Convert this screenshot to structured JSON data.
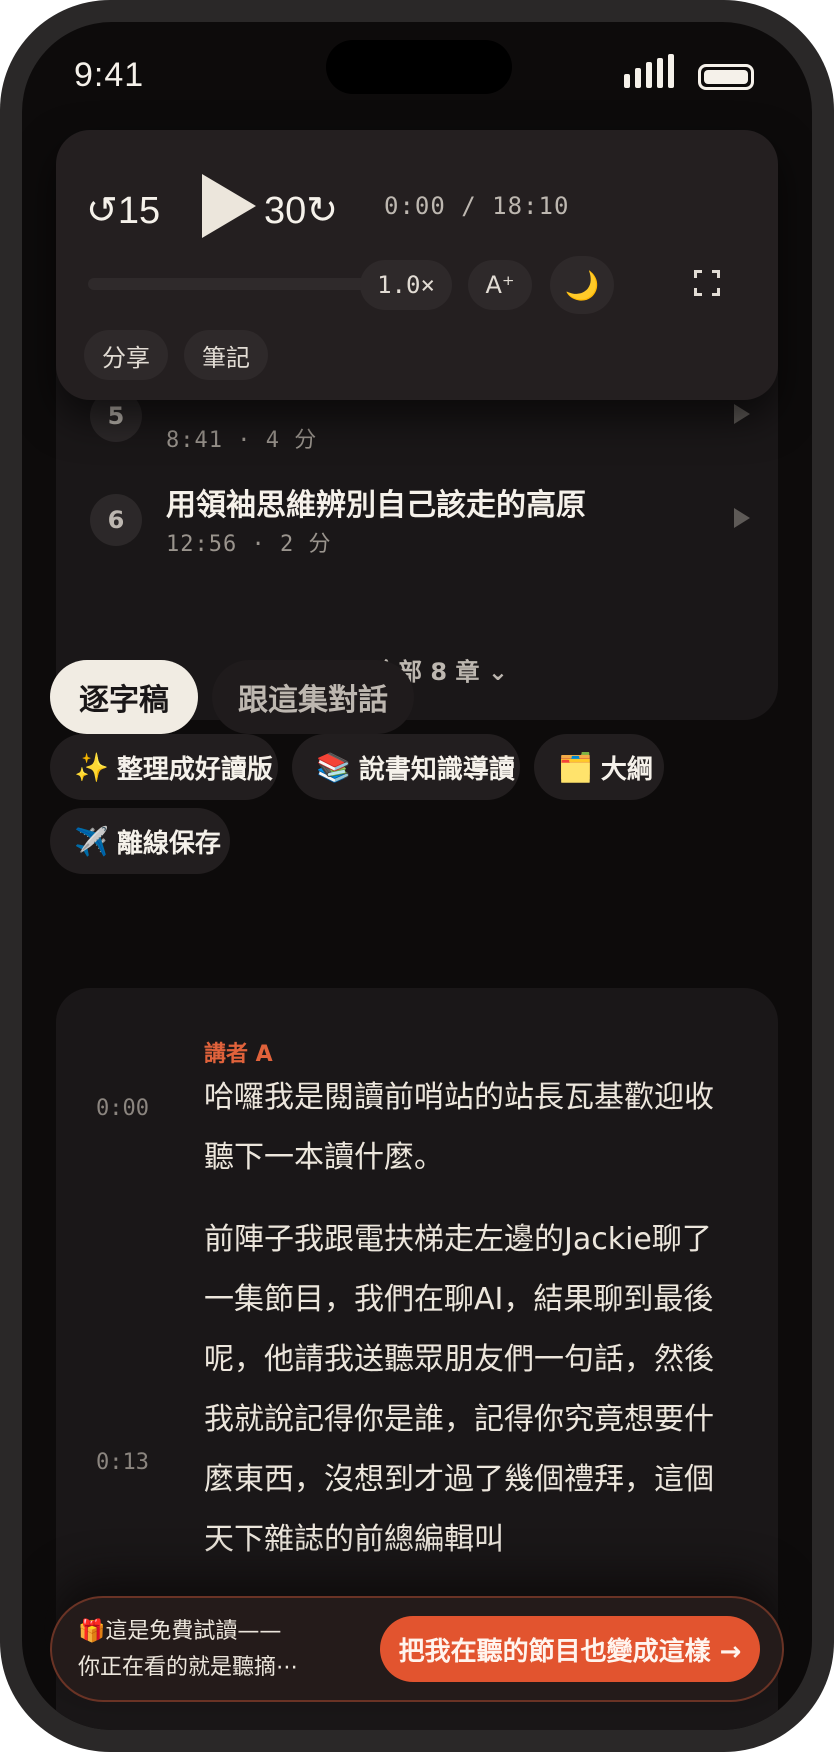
{
  "status_bar": {
    "time": "9:41"
  },
  "player": {
    "rewind_label": "↺15",
    "forward_label": "30↻",
    "time_readout": "0:00 / 18:10",
    "progress": 0,
    "speed_label": "1.0×",
    "font_size_label": "A⁺",
    "night_mode_label": "🌙",
    "share_label": "分享",
    "notes_label": "筆記"
  },
  "chapters": {
    "items": [
      {
        "number": "5",
        "title": "",
        "meta": "8:41 · 4 分"
      },
      {
        "number": "6",
        "title": "用領袖思維辨別自己該走的高原",
        "meta": "12:56 · 2 分"
      }
    ],
    "expand_label": "展開全部 8 章 ⌄"
  },
  "tabs": [
    {
      "label": "逐字稿",
      "active": true
    },
    {
      "label": "跟這集對話",
      "active": false
    }
  ],
  "actions": [
    {
      "emoji": "✨",
      "label": "整理成好讀版"
    },
    {
      "emoji": "📚",
      "label": "說書知識導讀"
    },
    {
      "emoji": "🗂️",
      "label": "大綱"
    },
    {
      "emoji": "✈️",
      "label": "離線保存"
    }
  ],
  "transcript": {
    "speaker": "講者 A",
    "segments": [
      {
        "time": "0:00",
        "text": "哈囉我是閱讀前哨站的站長瓦基歡迎收聽下一本讀什麼。"
      },
      {
        "time": "0:13",
        "text": "前陣子我跟電扶梯走左邊的Jackie聊了一集節目，我們在聊AI，結果聊到最後呢，他請我送聽眾朋友們一句話，然後我就說記得你是誰，記得你究竟想要什麼東西，沒想到才過了幾個禮拜，這個天下雜誌的前總編輯叫"
      }
    ]
  },
  "cta": {
    "line1": "🎁這是免費試讀——",
    "line2": "你正在看的就是聽摘⋯",
    "button_label": "把我在聽的節目也變成這樣 →"
  },
  "colors": {
    "accent": "#e2542f",
    "speaker": "#e0623b",
    "background": "#0d0b0b",
    "card": "#1a1718"
  }
}
